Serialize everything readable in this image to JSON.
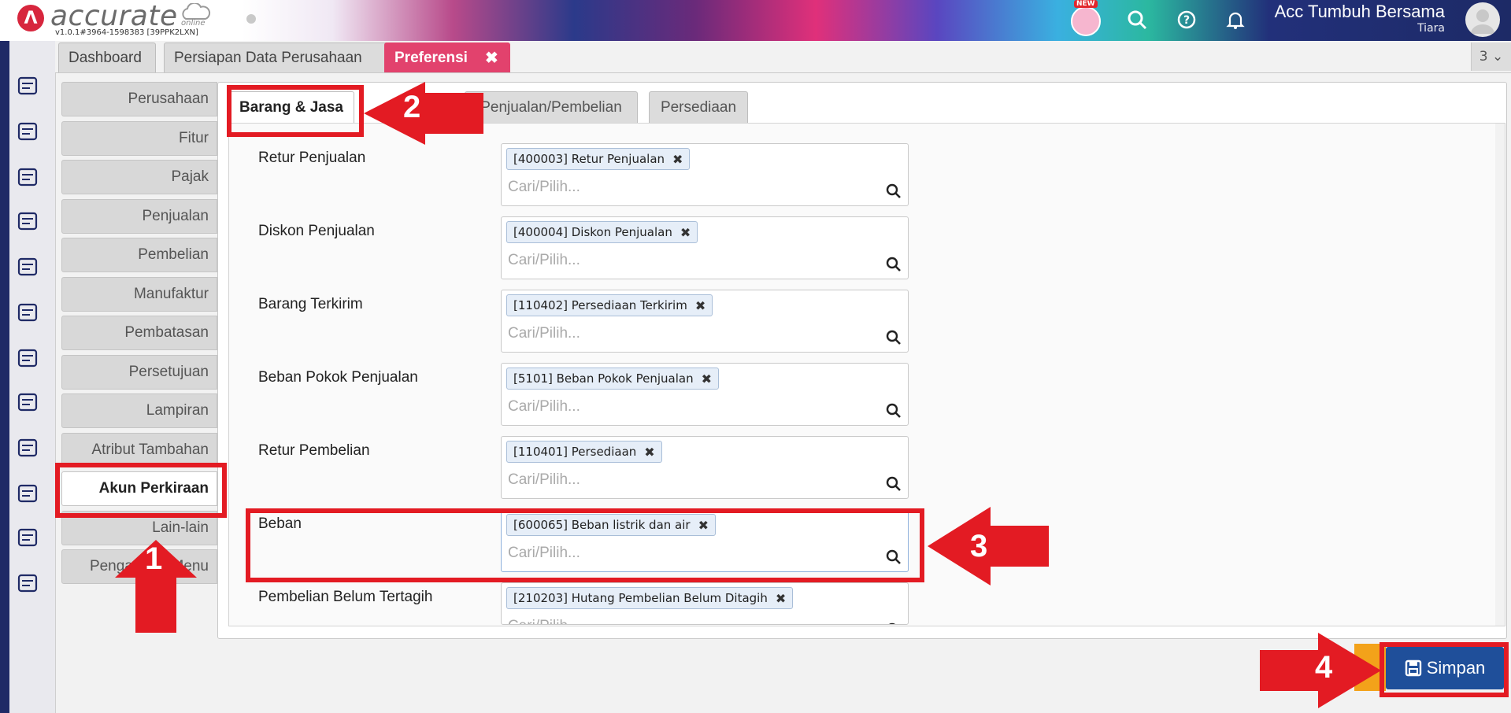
{
  "header": {
    "logo_text": "accurate",
    "logo_sub": "online",
    "version": "v1.0.1#3964-1598383 [39PPK2LXN]",
    "new_badge": "NEW",
    "company_name": "Acc Tumbuh Bersama",
    "user_name": "Tiara",
    "icons": [
      "mascot-icon",
      "search-icon",
      "help-icon",
      "bell-icon",
      "avatar"
    ]
  },
  "sidebar_icons": [
    "gear-icon",
    "cash-register-icon",
    "building-icon",
    "book-icon",
    "bank-icon",
    "money-bag-icon",
    "cart-icon",
    "cart-box-icon",
    "factory-icon",
    "truck-icon",
    "tax-icon",
    "chart-icon"
  ],
  "top_tabs": [
    {
      "label": "Dashboard"
    },
    {
      "label": "Persiapan Data Perusahaan"
    },
    {
      "label": "Preferensi",
      "close": "✖"
    }
  ],
  "tab_count": "3 ⌄",
  "pref_menu": [
    "Perusahaan",
    "Fitur",
    "Pajak",
    "Penjualan",
    "Pembelian",
    "Manufaktur",
    "Pembatasan",
    "Persetujuan",
    "Lampiran",
    "Atribut Tambahan",
    "Akun Perkiraan",
    "Lain-lain",
    "Pengaturan Menu"
  ],
  "sub_tabs": [
    "Barang & Jasa",
    "Penjualan/Pembelian",
    "Persediaan"
  ],
  "fields": [
    {
      "label": "Retur Penjualan",
      "chip": "[400003] Retur Penjualan",
      "placeholder": "Cari/Pilih..."
    },
    {
      "label": "Diskon Penjualan",
      "chip": "[400004] Diskon Penjualan",
      "placeholder": "Cari/Pilih..."
    },
    {
      "label": "Barang Terkirim",
      "chip": "[110402] Persediaan Terkirim",
      "placeholder": "Cari/Pilih..."
    },
    {
      "label": "Beban Pokok Penjualan",
      "chip": "[5101] Beban Pokok Penjualan",
      "placeholder": "Cari/Pilih..."
    },
    {
      "label": "Retur Pembelian",
      "chip": "[110401] Persediaan",
      "placeholder": "Cari/Pilih..."
    },
    {
      "label": "Beban",
      "chip": "[600065] Beban listrik dan air",
      "placeholder": "Cari/Pilih..."
    },
    {
      "label": "Pembelian Belum Tertagih",
      "chip": "[210203] Hutang Pembelian Belum Ditagih",
      "placeholder": "Cari/Pilih..."
    }
  ],
  "save_label": "Simpan",
  "annotations": [
    "1",
    "2",
    "3",
    "4"
  ],
  "colors": {
    "accent": "#e2426d",
    "navy": "#1f2a66",
    "save": "#1f4f9a",
    "highlight": "#e31b23"
  }
}
